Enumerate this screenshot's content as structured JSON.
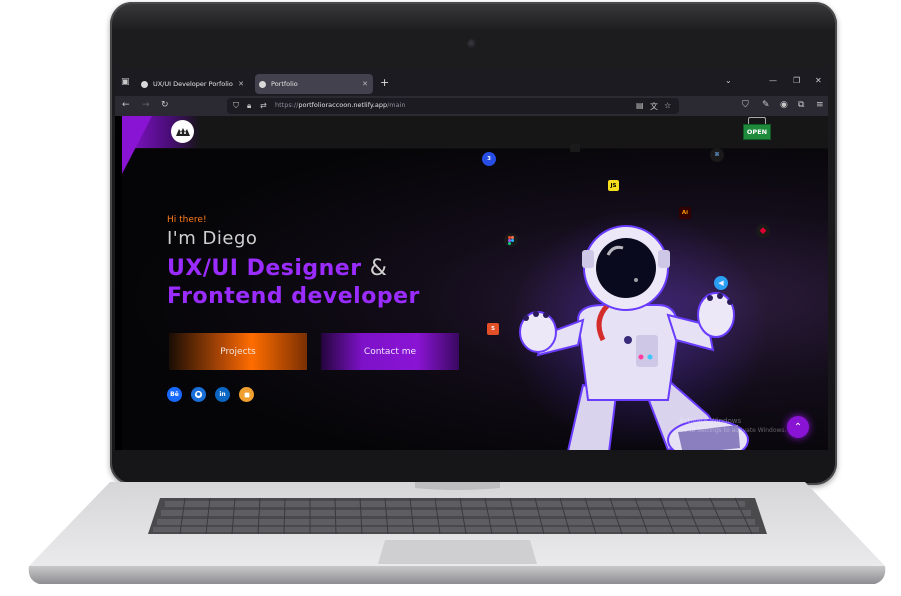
{
  "browser": {
    "tabs": [
      {
        "label": "UX/UI Developer Porfolio",
        "active": false
      },
      {
        "label": "Portfolio",
        "active": true
      }
    ],
    "url_prefix": "https://",
    "url_host": "portfolioraccoon.netlify.app",
    "url_path": "/main"
  },
  "site": {
    "open_sign": "OPEN",
    "greeting": "Hi there!",
    "name": "I'm Diego",
    "role_line1": "UX/UI Designer",
    "ampersand": "&",
    "role_line2": "Frontend developer",
    "buttons": {
      "projects": "Projects",
      "contact": "Contact me"
    },
    "social": [
      {
        "icon": "behance-icon",
        "label": "Bē",
        "color": "#1769ff"
      },
      {
        "icon": "github-icon",
        "label": "",
        "color": "#1a6ed8"
      },
      {
        "icon": "linkedin-icon",
        "label": "in",
        "color": "#0a66c2"
      },
      {
        "icon": "blog-icon",
        "label": "",
        "color": "#f0a030"
      }
    ],
    "tech_icons": [
      {
        "icon": "css3-icon",
        "label": "3"
      },
      {
        "icon": "javascript-icon",
        "label": "JS"
      },
      {
        "icon": "illustrator-icon",
        "label": "Ai"
      },
      {
        "icon": "figma-icon",
        "label": ""
      },
      {
        "icon": "html5-icon",
        "label": "5"
      },
      {
        "icon": "github-icon",
        "label": ""
      },
      {
        "icon": "angular-icon",
        "label": ""
      },
      {
        "icon": "vscode-icon",
        "label": ""
      }
    ]
  },
  "os": {
    "watermark_line1": "Activate Windows",
    "watermark_line2": "Go to Settings to activate Windows."
  },
  "colors": {
    "accent_purple": "#8a14d4",
    "accent_orange": "#ff7b1a",
    "open_green": "#1e8a3b"
  }
}
